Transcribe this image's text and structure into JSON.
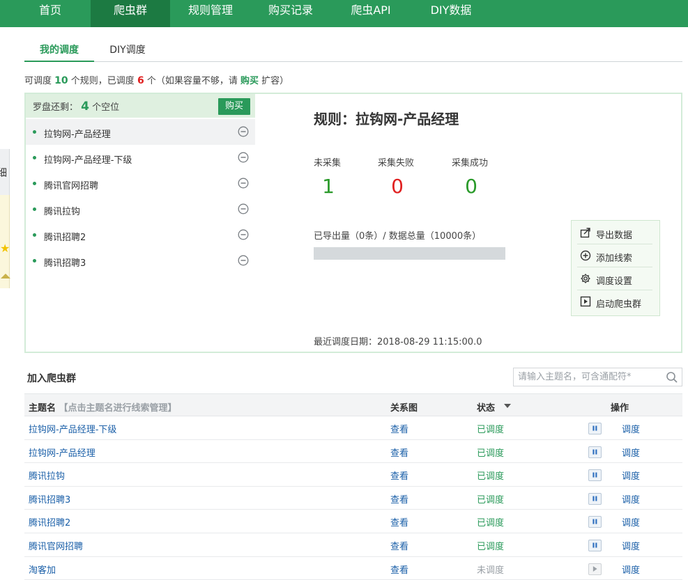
{
  "nav": {
    "items": [
      {
        "label": "首页",
        "active": false
      },
      {
        "label": "爬虫群",
        "active": true
      },
      {
        "label": "规则管理",
        "active": false
      },
      {
        "label": "购买记录",
        "active": false
      },
      {
        "label": "爬虫API",
        "active": false
      },
      {
        "label": "DIY数据",
        "active": false
      }
    ]
  },
  "left_strip": {
    "glyph": "细"
  },
  "tabs": [
    {
      "label": "我的调度",
      "active": true
    },
    {
      "label": "DIY调度",
      "active": false
    }
  ],
  "capacity": {
    "prefix": "可调度",
    "total": "10",
    "mid": "个规则，已调度",
    "used": "6",
    "suffix1": "个（如果容量不够，请",
    "buy_link": "购买",
    "suffix2": "扩容）"
  },
  "compass": {
    "label": "罗盘还剩：",
    "count": "4",
    "unit": "个空位",
    "buy_button": "购买"
  },
  "rules": [
    {
      "label": "拉钩网-产品经理",
      "selected": true
    },
    {
      "label": "拉钩网-产品经理-下级",
      "selected": false
    },
    {
      "label": "腾讯官网招聘",
      "selected": false
    },
    {
      "label": "腾讯拉钩",
      "selected": false
    },
    {
      "label": "腾讯招聘2",
      "selected": false
    },
    {
      "label": "腾讯招聘3",
      "selected": false
    }
  ],
  "detail": {
    "title": "规则：拉钩网-产品经理",
    "stats": [
      {
        "label": "未采集",
        "value": "1",
        "color": "#2a9a2a"
      },
      {
        "label": "采集失败",
        "value": "0",
        "color": "#e02020"
      },
      {
        "label": "采集成功",
        "value": "0",
        "color": "#2a9a2a"
      }
    ],
    "export_line": "已导出量（0条）/ 数据总量（10000条）",
    "progress_fraction": 0,
    "last_date": "最近调度日期：2018-08-29 11:15:00.0",
    "actions": [
      {
        "label": "导出数据",
        "icon": "export-icon"
      },
      {
        "label": "添加线索",
        "icon": "add-circle-icon"
      },
      {
        "label": "调度设置",
        "icon": "gear-icon"
      },
      {
        "label": "启动爬虫群",
        "icon": "play-icon"
      }
    ]
  },
  "join": {
    "title": "加入爬虫群",
    "search_placeholder": "请输入主题名，可含通配符*"
  },
  "table": {
    "headers": {
      "name": "主题名",
      "name_hint": "【点击主题名进行线索管理】",
      "relation": "关系图",
      "status": "状态",
      "ops": "操作"
    },
    "rows": [
      {
        "name": "拉钩网-产品经理-下级",
        "view": "查看",
        "status": "已调度",
        "scheduled": true,
        "op": "调度"
      },
      {
        "name": "拉钩网-产品经理",
        "view": "查看",
        "status": "已调度",
        "scheduled": true,
        "op": "调度"
      },
      {
        "name": "腾讯拉钩",
        "view": "查看",
        "status": "已调度",
        "scheduled": true,
        "op": "调度"
      },
      {
        "name": "腾讯招聘3",
        "view": "查看",
        "status": "已调度",
        "scheduled": true,
        "op": "调度"
      },
      {
        "name": "腾讯招聘2",
        "view": "查看",
        "status": "已调度",
        "scheduled": true,
        "op": "调度"
      },
      {
        "name": "腾讯官网招聘",
        "view": "查看",
        "status": "已调度",
        "scheduled": true,
        "op": "调度"
      },
      {
        "name": "淘客加",
        "view": "查看",
        "status": "未调度",
        "scheduled": false,
        "op": "调度"
      }
    ]
  },
  "colors": {
    "brand_green": "#2a9a5a",
    "link_blue": "#1a5fa8",
    "alert_red": "#e02020",
    "muted_gray": "#9aa0a6"
  }
}
